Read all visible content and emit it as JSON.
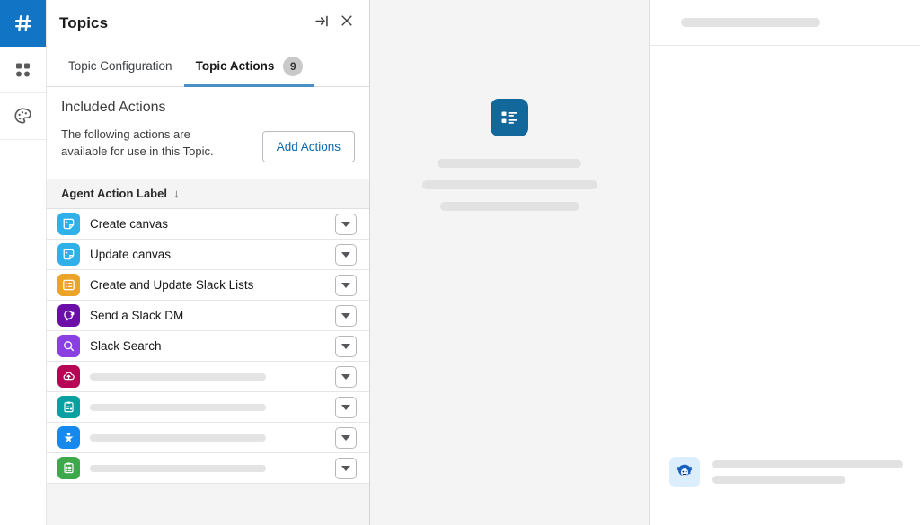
{
  "rail": {
    "items": [
      {
        "name": "slack-hash-icon",
        "label": "Slack",
        "active": true
      },
      {
        "name": "apps-grid-icon",
        "label": "App Launcher",
        "active": false
      },
      {
        "name": "palette-icon",
        "label": "Theme",
        "active": false
      }
    ]
  },
  "panel": {
    "title": "Topics",
    "header_buttons": [
      {
        "name": "expand-panel-icon",
        "label": "Expand"
      },
      {
        "name": "close-icon",
        "label": "Close"
      }
    ],
    "tabs": [
      {
        "label": "Topic Configuration",
        "active": false,
        "badge": ""
      },
      {
        "label": "Topic Actions",
        "active": true,
        "badge": "9"
      }
    ],
    "included": {
      "title": "Included Actions",
      "description": "The following actions are available for use in this Topic.",
      "add_button": "Add Actions"
    },
    "table": {
      "column_header": "Agent Action Label",
      "sort_indicator": "↓",
      "rows": [
        {
          "label": "Create canvas",
          "icon": "canvas-icon",
          "color": "#2FB0E8",
          "skeleton": false
        },
        {
          "label": "Update canvas",
          "icon": "canvas-icon",
          "color": "#2FB0E8",
          "skeleton": false
        },
        {
          "label": "Create and Update Slack Lists",
          "icon": "slack-lists-icon",
          "color": "#ECA32A",
          "skeleton": false
        },
        {
          "label": "Send a Slack DM",
          "icon": "slack-dm-icon",
          "color": "#6C0FA9",
          "skeleton": false
        },
        {
          "label": "Slack Search",
          "icon": "slack-search-icon",
          "color": "#8A3FE0",
          "skeleton": false
        },
        {
          "label": "",
          "icon": "upload-cloud-icon",
          "color": "#B60554",
          "skeleton": true,
          "skeleton_width": 196
        },
        {
          "label": "",
          "icon": "clipboard-sync-icon",
          "color": "#08A0A0",
          "skeleton": true,
          "skeleton_width": 196
        },
        {
          "label": "",
          "icon": "star-person-icon",
          "color": "#1589EE",
          "skeleton": true,
          "skeleton_width": 196
        },
        {
          "label": "",
          "icon": "clipboard-list-icon",
          "color": "#3EA94B",
          "skeleton": true,
          "skeleton_width": 196
        }
      ],
      "row_menu_icon": "chevron-down-icon"
    }
  },
  "middle": {
    "placeholder_icon": "list-detail-icon",
    "placeholder_color": "#12679B",
    "skeleton_widths": [
      160,
      195,
      155
    ]
  },
  "right": {
    "header_skeleton_width": 155,
    "avatar_icon": "einstein-avatar-icon",
    "message_skeleton_widths": [
      212,
      148
    ]
  }
}
